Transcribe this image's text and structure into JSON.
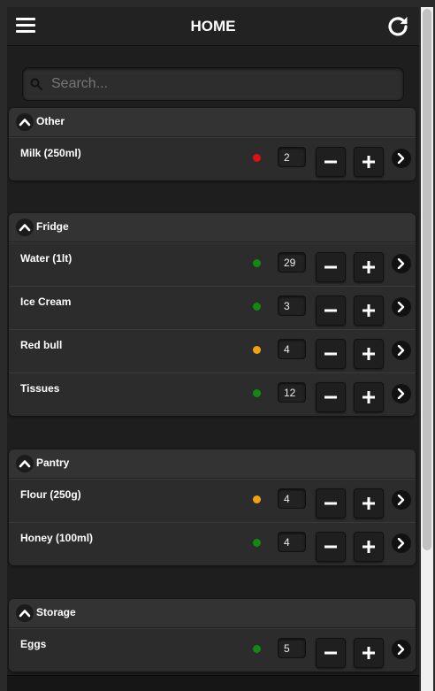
{
  "header": {
    "title": "HOME"
  },
  "search": {
    "placeholder": "Search..."
  },
  "sections": [
    {
      "title": "Other",
      "items": [
        {
          "name": "Milk (250ml)",
          "status": "red",
          "qty": "2"
        }
      ]
    },
    {
      "title": "Fridge",
      "items": [
        {
          "name": "Water (1lt)",
          "status": "green",
          "qty": "29"
        },
        {
          "name": "Ice Cream",
          "status": "green",
          "qty": "3"
        },
        {
          "name": "Red bull",
          "status": "orange",
          "qty": "4"
        },
        {
          "name": "Tissues",
          "status": "green",
          "qty": "12"
        }
      ]
    },
    {
      "title": "Pantry",
      "items": [
        {
          "name": "Flour (250g)",
          "status": "orange",
          "qty": "4"
        },
        {
          "name": "Honey (100ml)",
          "status": "green",
          "qty": "4"
        }
      ]
    },
    {
      "title": "Storage",
      "items": [
        {
          "name": "Eggs",
          "status": "green",
          "qty": "5"
        }
      ]
    }
  ],
  "footer": {
    "text": ""
  },
  "colors": {
    "red": "#e01010",
    "green": "#128a12",
    "orange": "#f0a010"
  },
  "icons": {
    "menu": "hamburger-icon",
    "refresh": "refresh-icon",
    "search": "search-icon",
    "collapse": "chevron-up-icon",
    "minus": "minus-icon",
    "plus": "plus-icon",
    "arrow": "chevron-right-icon"
  }
}
